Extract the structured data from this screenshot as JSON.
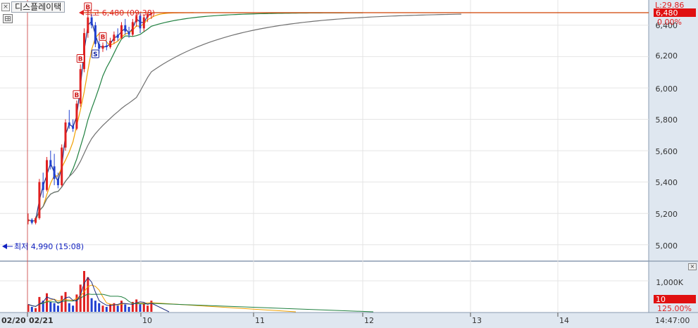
{
  "window": {
    "tab_label": "디스플레이택",
    "tab_close": "×",
    "grid_button": "grid-icon"
  },
  "price_panel": {
    "y_ticks": [
      "6,400",
      "6,200",
      "6,000",
      "5,800",
      "5,600",
      "5,400",
      "5,200",
      "5,000"
    ],
    "right_labels": {
      "change_text": "L:29.86",
      "current_price": "6,480",
      "percent": "0.00%"
    },
    "high_annotation": "최고 6,480 (09:38)",
    "low_annotation": "최저 4,990 (15:08)",
    "signals": [
      {
        "label": "B",
        "type": "buy"
      },
      {
        "label": "B",
        "type": "buy"
      },
      {
        "label": "B",
        "type": "buy"
      },
      {
        "label": "S",
        "type": "sell"
      },
      {
        "label": "B",
        "type": "buy"
      }
    ]
  },
  "volume_panel": {
    "y_tick": "1,000K",
    "badge_value": "10",
    "percent": "125.00%",
    "ctrl_label": "×"
  },
  "x_axis": {
    "labels": [
      "02/20",
      "02/21",
      "10",
      "11",
      "12",
      "13",
      "14"
    ],
    "time_readout": "14:47:00"
  },
  "colors": {
    "up": "#e02020",
    "down": "#2040d0",
    "ma_orange": "#f0a000",
    "ma_green": "#208040",
    "ma_gray": "#707070",
    "ma_navy": "#203080",
    "price_line": "#d04000",
    "axis_bg": "#dfe7f0",
    "badge_red": "#e01010"
  },
  "chart_data": [
    {
      "type": "candlestick",
      "title": "",
      "price_range": [
        4950,
        6480
      ],
      "high": 6480,
      "low": 4990,
      "current": 6480,
      "candles": [
        {
          "o": 5150,
          "h": 5200,
          "l": 5130,
          "c": 5160,
          "v": 60
        },
        {
          "o": 5160,
          "h": 5170,
          "l": 5130,
          "c": 5140,
          "v": 40
        },
        {
          "o": 5140,
          "h": 5180,
          "l": 5130,
          "c": 5170,
          "v": 30
        },
        {
          "o": 5170,
          "h": 5420,
          "l": 5160,
          "c": 5400,
          "v": 120
        },
        {
          "o": 5400,
          "h": 5460,
          "l": 5300,
          "c": 5350,
          "v": 90
        },
        {
          "o": 5350,
          "h": 5560,
          "l": 5340,
          "c": 5540,
          "v": 150
        },
        {
          "o": 5540,
          "h": 5600,
          "l": 5480,
          "c": 5500,
          "v": 80
        },
        {
          "o": 5500,
          "h": 5580,
          "l": 5380,
          "c": 5420,
          "v": 70
        },
        {
          "o": 5420,
          "h": 5460,
          "l": 5360,
          "c": 5380,
          "v": 50
        },
        {
          "o": 5380,
          "h": 5640,
          "l": 5370,
          "c": 5620,
          "v": 130
        },
        {
          "o": 5620,
          "h": 5800,
          "l": 5600,
          "c": 5780,
          "v": 160
        },
        {
          "o": 5780,
          "h": 5860,
          "l": 5740,
          "c": 5760,
          "v": 70
        },
        {
          "o": 5760,
          "h": 5800,
          "l": 5720,
          "c": 5740,
          "v": 50
        },
        {
          "o": 5740,
          "h": 5920,
          "l": 5730,
          "c": 5900,
          "v": 140
        },
        {
          "o": 5900,
          "h": 6150,
          "l": 5880,
          "c": 6120,
          "v": 220
        },
        {
          "o": 6120,
          "h": 6380,
          "l": 6100,
          "c": 6350,
          "v": 330
        },
        {
          "o": 6350,
          "h": 6480,
          "l": 6320,
          "c": 6450,
          "v": 280
        },
        {
          "o": 6450,
          "h": 6470,
          "l": 6380,
          "c": 6400,
          "v": 110
        },
        {
          "o": 6400,
          "h": 6420,
          "l": 6260,
          "c": 6280,
          "v": 90
        },
        {
          "o": 6280,
          "h": 6300,
          "l": 6220,
          "c": 6250,
          "v": 70
        },
        {
          "o": 6250,
          "h": 6290,
          "l": 6230,
          "c": 6270,
          "v": 50
        },
        {
          "o": 6270,
          "h": 6300,
          "l": 6240,
          "c": 6260,
          "v": 40
        },
        {
          "o": 6260,
          "h": 6320,
          "l": 6250,
          "c": 6300,
          "v": 60
        },
        {
          "o": 6300,
          "h": 6360,
          "l": 6280,
          "c": 6340,
          "v": 70
        },
        {
          "o": 6340,
          "h": 6380,
          "l": 6300,
          "c": 6320,
          "v": 50
        },
        {
          "o": 6320,
          "h": 6420,
          "l": 6310,
          "c": 6400,
          "v": 90
        },
        {
          "o": 6400,
          "h": 6440,
          "l": 6340,
          "c": 6360,
          "v": 60
        },
        {
          "o": 6360,
          "h": 6390,
          "l": 6320,
          "c": 6340,
          "v": 40
        },
        {
          "o": 6340,
          "h": 6440,
          "l": 6330,
          "c": 6420,
          "v": 80
        },
        {
          "o": 6420,
          "h": 6480,
          "l": 6390,
          "c": 6460,
          "v": 100
        },
        {
          "o": 6460,
          "h": 6480,
          "l": 6350,
          "c": 6380,
          "v": 60
        },
        {
          "o": 6380,
          "h": 6470,
          "l": 6360,
          "c": 6450,
          "v": 70
        },
        {
          "o": 6450,
          "h": 6480,
          "l": 6420,
          "c": 6470,
          "v": 50
        },
        {
          "o": 6470,
          "h": 6480,
          "l": 6440,
          "c": 6480,
          "v": 90
        }
      ]
    },
    {
      "type": "bar",
      "title": "",
      "ylabel": "1,000K",
      "series": [
        {
          "values": [
            60,
            40,
            30,
            120,
            90,
            150,
            80,
            70,
            50,
            130,
            160,
            70,
            50,
            140,
            220,
            330,
            280,
            110,
            90,
            70,
            50,
            40,
            60,
            70,
            50,
            90,
            60,
            40,
            80,
            100,
            60,
            70,
            50,
            90
          ]
        }
      ]
    }
  ]
}
